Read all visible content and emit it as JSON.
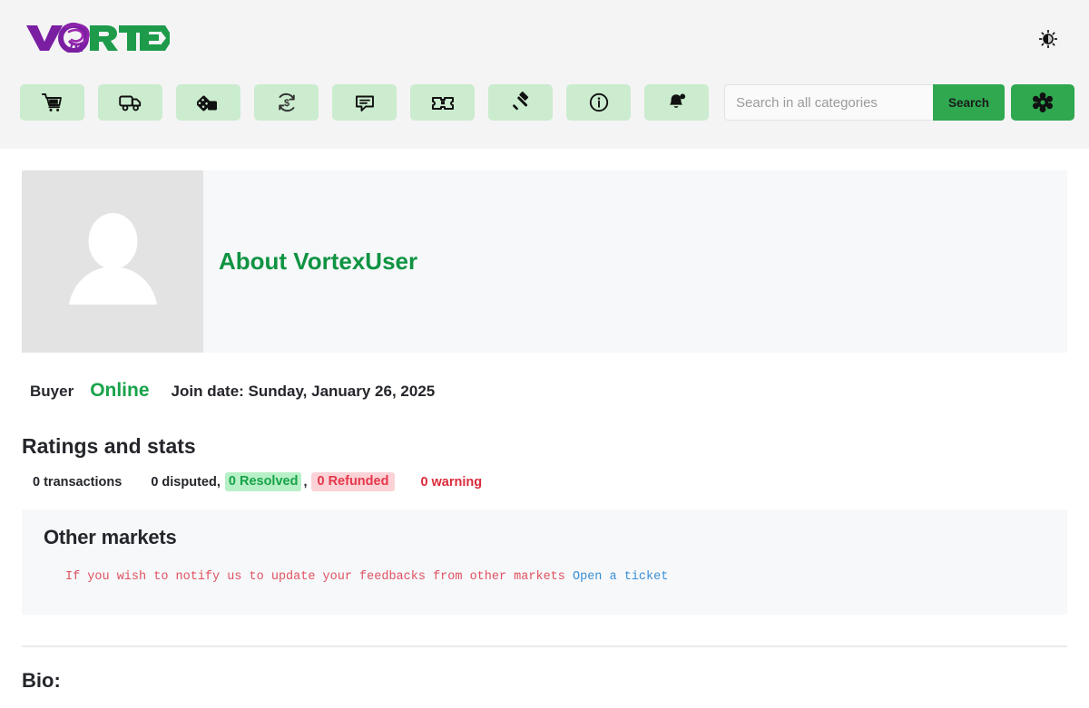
{
  "header": {
    "logo": {
      "text_purple": "VO",
      "text_green": "RTEX",
      "alt": "Vortex logo"
    },
    "theme_toggle": {
      "icon": "sun-icon",
      "label": "Toggle theme"
    },
    "nav_items": [
      {
        "id": "cart",
        "icon": "shopping-cart-icon",
        "label": "Cart"
      },
      {
        "id": "orders",
        "icon": "delivery-truck-icon",
        "label": "Orders"
      },
      {
        "id": "listings",
        "icon": "cards-dice-icon",
        "label": "Listings"
      },
      {
        "id": "wallet",
        "icon": "money-refresh-icon",
        "label": "Wallet"
      },
      {
        "id": "messages",
        "icon": "chat-bubble-icon",
        "label": "Messages"
      },
      {
        "id": "tickets",
        "icon": "ticket-icon",
        "label": "Tickets"
      },
      {
        "id": "disputes",
        "icon": "gavel-icon",
        "label": "Disputes"
      },
      {
        "id": "info",
        "icon": "info-circle-icon",
        "label": "Info"
      },
      {
        "id": "notifications",
        "icon": "bell-icon",
        "label": "Notifications"
      }
    ],
    "search": {
      "placeholder": "Search in all categories",
      "value": "",
      "button_label": "Search"
    },
    "settings_button": {
      "icon": "gear-icon",
      "label": "Settings"
    }
  },
  "profile": {
    "avatar": {
      "icon": "user-silhouette-icon",
      "alt": "Default user avatar"
    },
    "title": "About VortexUser",
    "role": "Buyer",
    "status": "Online",
    "join_date": "Join date: Sunday, January 26, 2025"
  },
  "ratings": {
    "heading": "Ratings and stats",
    "transactions": "0 transactions",
    "disputed": "0 disputed,",
    "resolved": "0 Resolved",
    "separator": ",",
    "refunded": "0 Refunded",
    "warning": "0 warning"
  },
  "other_markets": {
    "title": "Other markets",
    "notice": "If you wish to notify us to update your feedbacks from other markets",
    "link_label": "Open a ticket"
  },
  "bio": {
    "heading": "Bio:"
  },
  "colors": {
    "brand_green": "#2fa84f",
    "title_green": "#0f9342",
    "status_green": "#19a34a",
    "logo_purple": "#7b1fa2",
    "nav_button_bg": "#cbecce",
    "badge_green_bg": "#b7f0c6",
    "badge_green_text": "#17a34a",
    "badge_red_bg": "#fbd3d7",
    "badge_red_text": "#e5374b",
    "warning_red": "#dc2b3c",
    "monospace_red": "#e05260",
    "link_blue": "#3b8fd4",
    "header_bg": "#f4f4f5",
    "card_bg": "#f6f8fa",
    "avatar_bg": "#e3e3e3"
  }
}
